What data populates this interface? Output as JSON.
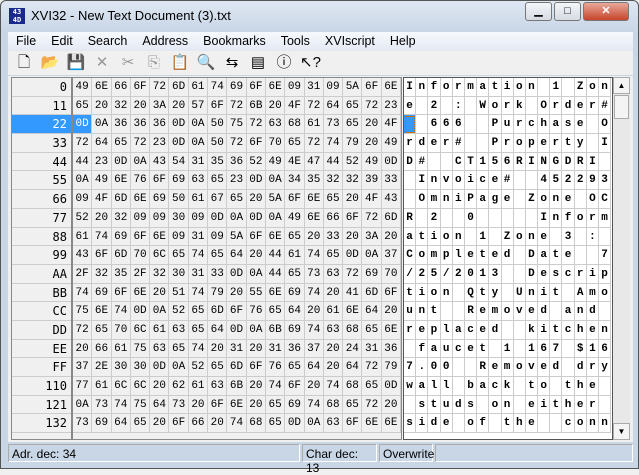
{
  "window": {
    "title": "XVI32 - New Text Document (3).txt",
    "icon_text": "43 4D",
    "minimize": "▁",
    "maximize": "□",
    "close": "✕"
  },
  "menu": [
    "File",
    "Edit",
    "Search",
    "Address",
    "Bookmarks",
    "Tools",
    "XVIscript",
    "Help"
  ],
  "toolbar": [
    {
      "name": "new-icon",
      "glyph": "🗋",
      "enabled": true
    },
    {
      "name": "open-icon",
      "glyph": "📂",
      "enabled": true
    },
    {
      "name": "save-icon",
      "glyph": "💾",
      "enabled": true
    },
    {
      "name": "delete-icon",
      "glyph": "✕",
      "enabled": false
    },
    {
      "name": "cut-icon",
      "glyph": "✂",
      "enabled": false
    },
    {
      "name": "copy-icon",
      "glyph": "⎘",
      "enabled": false
    },
    {
      "name": "paste-icon",
      "glyph": "📋",
      "enabled": true
    },
    {
      "name": "find-icon",
      "glyph": "🔍",
      "enabled": true
    },
    {
      "name": "replace-icon",
      "glyph": "⇆",
      "enabled": true
    },
    {
      "name": "properties-icon",
      "glyph": "▤",
      "enabled": true
    },
    {
      "name": "info-icon",
      "glyph": "ⓘ",
      "enabled": true
    },
    {
      "name": "help-pointer-icon",
      "glyph": "↖?",
      "enabled": true
    }
  ],
  "selected_offset_row": 2,
  "selected_col": 0,
  "rows": [
    {
      "offset": "0",
      "hex": "49 6E 66 6F 72 6D 61 74 69 6F 6E 09 31 09 5A 6F 6E"
    },
    {
      "offset": "11",
      "hex": "65 20 32 20 3A 20 57 6F 72 6B 20 4F 72 64 65 72 23"
    },
    {
      "offset": "22",
      "hex": "0D 0A 36 36 36 0D 0A 50 75 72 63 68 61 73 65 20 4F"
    },
    {
      "offset": "33",
      "hex": "72 64 65 72 23 0D 0A 50 72 6F 70 65 72 74 79 20 49"
    },
    {
      "offset": "44",
      "hex": "44 23 0D 0A 43 54 31 35 36 52 49 4E 47 44 52 49 0D"
    },
    {
      "offset": "55",
      "hex": "0A 49 6E 76 6F 69 63 65 23 0D 0A 34 35 32 32 39 33"
    },
    {
      "offset": "66",
      "hex": "09 4F 6D 6E 69 50 61 67 65 20 5A 6F 6E 65 20 4F 43"
    },
    {
      "offset": "77",
      "hex": "52 20 32 09 09 30 09 0D 0A 0D 0A 49 6E 66 6F 72 6D"
    },
    {
      "offset": "88",
      "hex": "61 74 69 6F 6E 09 31 09 5A 6F 6E 65 20 33 20 3A 20"
    },
    {
      "offset": "99",
      "hex": "43 6F 6D 70 6C 65 74 65 64 20 44 61 74 65 0D 0A 37"
    },
    {
      "offset": "AA",
      "hex": "2F 32 35 2F 32 30 31 33 0D 0A 44 65 73 63 72 69 70"
    },
    {
      "offset": "BB",
      "hex": "74 69 6F 6E 20 51 74 79 20 55 6E 69 74 20 41 6D 6F"
    },
    {
      "offset": "CC",
      "hex": "75 6E 74 0D 0A 52 65 6D 6F 76 65 64 20 61 6E 64 20"
    },
    {
      "offset": "DD",
      "hex": "72 65 70 6C 61 63 65 64 0D 0A 6B 69 74 63 68 65 6E"
    },
    {
      "offset": "EE",
      "hex": "20 66 61 75 63 65 74 20 31 20 31 36 37 20 24 31 36"
    },
    {
      "offset": "FF",
      "hex": "37 2E 30 30 0D 0A 52 65 6D 6F 76 65 64 20 64 72 79"
    },
    {
      "offset": "110",
      "hex": "77 61 6C 6C 20 62 61 63 6B 20 74 6F 20 74 68 65 0D"
    },
    {
      "offset": "121",
      "hex": "0A 73 74 75 64 73 20 6F 6E 20 65 69 74 68 65 72 20"
    },
    {
      "offset": "132",
      "hex": "73 69 64 65 20 6F 66 20 74 68 65 0D 0A 63 6F 6E 6E"
    }
  ],
  "status": {
    "address": "Adr. dec: 34",
    "char": "Char dec: 13",
    "mode": "Overwrite"
  },
  "scrollbar": {
    "up": "▲",
    "down": "▼"
  }
}
